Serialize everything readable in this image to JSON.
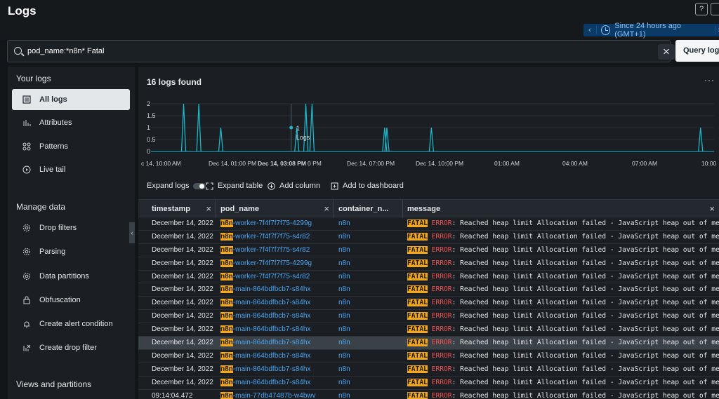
{
  "header": {
    "title": "Logs",
    "help_icon": "?",
    "time_range": "Since 24 hours ago (GMT+1)"
  },
  "search": {
    "value": "pod_name:*n8n* Fatal",
    "clear_glyph": "×",
    "query_button": "Query logs"
  },
  "sidebar": {
    "your_logs_heading": "Your logs",
    "your_logs_items": [
      {
        "label": "All logs",
        "icon": "list-icon",
        "active": true
      },
      {
        "label": "Attributes",
        "icon": "bar-chart-icon"
      },
      {
        "label": "Patterns",
        "icon": "patterns-icon"
      },
      {
        "label": "Live tail",
        "icon": "play-icon"
      }
    ],
    "manage_heading": "Manage data",
    "manage_items": [
      {
        "label": "Drop filters",
        "icon": "gear-icon"
      },
      {
        "label": "Parsing",
        "icon": "gear-icon"
      },
      {
        "label": "Data partitions",
        "icon": "gear-icon"
      },
      {
        "label": "Obfuscation",
        "icon": "lock-icon"
      },
      {
        "label": "Create alert condition",
        "icon": "bell-icon"
      },
      {
        "label": "Create drop filter",
        "icon": "filter-icon"
      }
    ],
    "views_heading": "Views and partitions"
  },
  "main": {
    "logs_found": "16 logs found",
    "more_glyph": "···"
  },
  "chart_data": {
    "type": "line",
    "y_ticks": [
      "0",
      "0.5",
      "1",
      "1.5",
      "2"
    ],
    "ylim": [
      0,
      2
    ],
    "x_ticks": [
      "c 14, 10:00 AM",
      "Dec 14, 01:00 PM",
      "Dec 14, 03:08 PM",
      "0 PM",
      "Dec 14, 07:00 PM",
      "Dec 14, 10:00 PM",
      "01:00 AM",
      "04:00 AM",
      "07:00 AM",
      "10:00"
    ],
    "spikes": [
      {
        "x_frac": 0.058,
        "value": 2
      },
      {
        "x_frac": 0.085,
        "value": 2
      },
      {
        "x_frac": 0.124,
        "value": 1
      },
      {
        "x_frac": 0.259,
        "value": 1
      },
      {
        "x_frac": 0.275,
        "value": 2
      },
      {
        "x_frac": 0.286,
        "value": 2
      },
      {
        "x_frac": 0.415,
        "value": 1
      },
      {
        "x_frac": 0.419,
        "value": 1
      },
      {
        "x_frac": 0.498,
        "value": 1
      },
      {
        "x_frac": 0.976,
        "value": 1
      }
    ],
    "tooltip": {
      "value": "1",
      "label": "Logs"
    },
    "color": "#1fb5c9",
    "grid": true
  },
  "toolbar": {
    "expand_logs": "Expand logs",
    "expand_table": "Expand table",
    "add_column": "Add column",
    "add_dashboard": "Add to dashboard"
  },
  "table": {
    "columns": [
      "timestamp",
      "pod_name",
      "container_n...",
      "message"
    ],
    "rows": [
      {
        "ts": "December 14, 2022 ...",
        "pod_prefix": "n8n",
        "pod_rest": "-worker-7f4f7f7f75-4299g",
        "container": "n8n"
      },
      {
        "ts": "December 14, 2022 ...",
        "pod_prefix": "n8n",
        "pod_rest": "-worker-7f4f7f7f75-s4r82",
        "container": "n8n"
      },
      {
        "ts": "December 14, 2022 ...",
        "pod_prefix": "n8n",
        "pod_rest": "-worker-7f4f7f7f75-s4r82",
        "container": "n8n"
      },
      {
        "ts": "December 14, 2022 ...",
        "pod_prefix": "n8n",
        "pod_rest": "-worker-7f4f7f7f75-4299g",
        "container": "n8n"
      },
      {
        "ts": "December 14, 2022 ...",
        "pod_prefix": "n8n",
        "pod_rest": "-worker-7f4f7f7f75-s4r82",
        "container": "n8n"
      },
      {
        "ts": "December 14, 2022 ...",
        "pod_prefix": "n8n",
        "pod_rest": "-main-864bdfbcb7-s84hx",
        "container": "n8n"
      },
      {
        "ts": "December 14, 2022 ...",
        "pod_prefix": "n8n",
        "pod_rest": "-main-864bdfbcb7-s84hx",
        "container": "n8n"
      },
      {
        "ts": "December 14, 2022 ...",
        "pod_prefix": "n8n",
        "pod_rest": "-main-864bdfbcb7-s84hx",
        "container": "n8n"
      },
      {
        "ts": "December 14, 2022 ...",
        "pod_prefix": "n8n",
        "pod_rest": "-main-864bdfbcb7-s84hx",
        "container": "n8n"
      },
      {
        "ts": "December 14, 2022 ...",
        "pod_prefix": "n8n",
        "pod_rest": "-main-864bdfbcb7-s84hx",
        "container": "n8n",
        "highlighted": true
      },
      {
        "ts": "December 14, 2022 ...",
        "pod_prefix": "n8n",
        "pod_rest": "-main-864bdfbcb7-s84hx",
        "container": "n8n"
      },
      {
        "ts": "December 14, 2022 ...",
        "pod_prefix": "n8n",
        "pod_rest": "-main-864bdfbcb7-s84hx",
        "container": "n8n"
      },
      {
        "ts": "December 14, 2022 ...",
        "pod_prefix": "n8n",
        "pod_rest": "-main-864bdfbcb7-s84hx",
        "container": "n8n"
      },
      {
        "ts": "09:14:04.472",
        "pod_prefix": "n8n",
        "pod_rest": "-main-77db47487b-w4bwv",
        "container": "n8n"
      }
    ],
    "message": {
      "fatal": "FATAL",
      "error": "ERROR",
      "rest": ": Reached heap limit Allocation failed - JavaScript heap out of memory"
    }
  }
}
